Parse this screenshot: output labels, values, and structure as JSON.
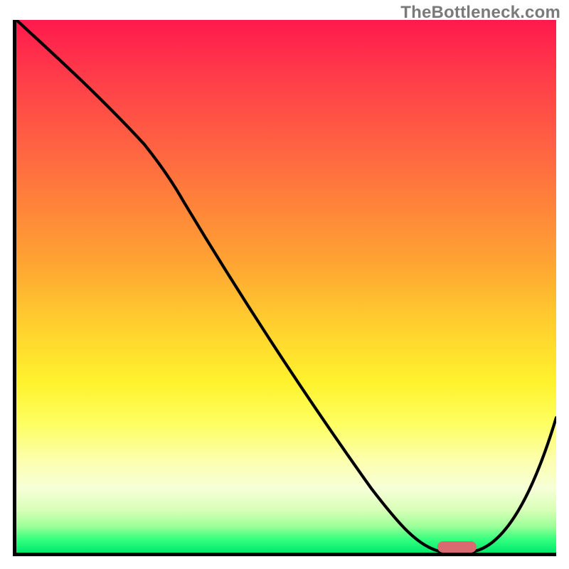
{
  "watermark": "TheBottleneck.com",
  "chart_data": {
    "type": "line",
    "title": "",
    "xlabel": "",
    "ylabel": "",
    "xlim": [
      0,
      100
    ],
    "ylim": [
      0,
      100
    ],
    "grid": false,
    "legend": false,
    "background_gradient": {
      "top": "#ff1a4d",
      "mid": "#fff22d",
      "bottom": "#00e86d",
      "note": "vertical gradient red→yellow→green across full y range"
    },
    "series": [
      {
        "name": "bottleneck-curve",
        "color": "#000000",
        "x": [
          0,
          8,
          16,
          24,
          30,
          38,
          46,
          54,
          62,
          70,
          75,
          80,
          84,
          88,
          92,
          96,
          100
        ],
        "y": [
          100,
          92,
          84,
          76,
          70,
          58,
          46,
          34,
          22,
          10,
          3,
          0,
          0,
          4,
          10,
          17,
          25
        ]
      }
    ],
    "markers": [
      {
        "name": "optimal-zone-marker",
        "shape": "rounded-bar",
        "color": "#d96a6f",
        "x_center": 82,
        "y": 1,
        "width_x_units": 7,
        "height_y_units": 2
      }
    ]
  }
}
